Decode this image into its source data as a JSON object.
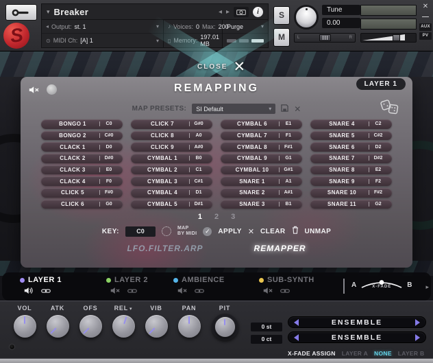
{
  "icons": {
    "close_x": "✕",
    "check": "✓",
    "caret_down": "▾",
    "caret_left": "◂",
    "caret_right": "▸",
    "minus": "—",
    "midi_plug": "⊙",
    "voices_note": "♪",
    "memory_chip": "▯",
    "info": "i",
    "logo_s": "S"
  },
  "colors": {
    "accent_purple": "#857ae8",
    "accent_cyan": "#62cfe3",
    "pink_glow": "#ce2c5c",
    "layer1_dot": "#a18cf2",
    "layer2_dot": "#8bd264",
    "ambience_dot": "#55b4e8",
    "subsynth_dot": "#e9c44f",
    "logo_red": "#c1272d"
  },
  "kontakt_header": {
    "title": "Breaker",
    "output": {
      "label": "Output:",
      "value": "st. 1"
    },
    "midi": {
      "label": "MIDI Ch:",
      "value": "[A] 1"
    },
    "voices": {
      "label": "Voices:",
      "value": "0"
    },
    "max": {
      "label": "Max:",
      "value": "200"
    },
    "memory": {
      "label": "Memory:",
      "value": "197.01 MB"
    },
    "purge_label": "Purge",
    "solo_label": "S",
    "mute_label": "M",
    "tune_label": "Tune",
    "tune_value": "0.00",
    "pan_left": "L",
    "pan_right": "R",
    "aux_label": "AUX",
    "pv_label": "PV"
  },
  "stage": {
    "close_label": "CLOSE"
  },
  "panel": {
    "title": "REMAPPING",
    "layer_badge": "LAYER 1",
    "presets_label": "MAP PRESETS:",
    "preset_value": "SI Default",
    "columns": [
      [
        {
          "name": "BONGO 1",
          "key": "C0"
        },
        {
          "name": "BONGO 2",
          "key": "C#0"
        },
        {
          "name": "CLACK 1",
          "key": "D0"
        },
        {
          "name": "CLACK 2",
          "key": "D#0"
        },
        {
          "name": "CLACK 3",
          "key": "E0"
        },
        {
          "name": "CLACK 4",
          "key": "F0"
        },
        {
          "name": "CLICK 5",
          "key": "F#0"
        },
        {
          "name": "CLICK 6",
          "key": "G0"
        }
      ],
      [
        {
          "name": "CLICK 7",
          "key": "G#0"
        },
        {
          "name": "CLICK 8",
          "key": "A0"
        },
        {
          "name": "CLICK 9",
          "key": "A#0"
        },
        {
          "name": "CYMBAL 1",
          "key": "B0"
        },
        {
          "name": "CYMBAL 2",
          "key": "C1"
        },
        {
          "name": "CYMBAL 3",
          "key": "C#1"
        },
        {
          "name": "CYMBAL 4",
          "key": "D1"
        },
        {
          "name": "CYMBAL 5",
          "key": "D#1"
        }
      ],
      [
        {
          "name": "CYMBAL 6",
          "key": "E1"
        },
        {
          "name": "CYMBAL 7",
          "key": "F1"
        },
        {
          "name": "CYMBAL 8",
          "key": "F#1"
        },
        {
          "name": "CYMBAL 9",
          "key": "G1"
        },
        {
          "name": "CYMBAL 10",
          "key": "G#1"
        },
        {
          "name": "SNARE 1",
          "key": "A1"
        },
        {
          "name": "SNARE 2",
          "key": "A#1"
        },
        {
          "name": "SNARE 3",
          "key": "B1"
        }
      ],
      [
        {
          "name": "SNARE 4",
          "key": "C2"
        },
        {
          "name": "SNARE 5",
          "key": "C#2"
        },
        {
          "name": "SNARE 6",
          "key": "D2"
        },
        {
          "name": "SNARE 7",
          "key": "D#2"
        },
        {
          "name": "SNARE 8",
          "key": "E2"
        },
        {
          "name": "SNARE 9",
          "key": "F2"
        },
        {
          "name": "SNARE 10",
          "key": "F#2"
        },
        {
          "name": "SNARE 11",
          "key": "G2"
        }
      ]
    ],
    "pages": [
      {
        "label": "1",
        "active": true
      },
      {
        "label": "2",
        "active": false
      },
      {
        "label": "3",
        "active": false
      }
    ],
    "key_label": "KEY:",
    "key_value": "C0",
    "map_by_midi_line1": "MAP",
    "map_by_midi_line2": "BY MIDI",
    "apply_label": "APPLY",
    "clear_label": "CLEAR",
    "unmap_label": "UNMAP",
    "tabs": [
      {
        "label": "LFO.FILTER.ARP",
        "active": false
      },
      {
        "label": "REMAPPER",
        "active": true
      }
    ]
  },
  "layer_bar": {
    "layers": [
      {
        "label": "LAYER 1",
        "dot_color": "#a18cf2",
        "muted": false,
        "active": true
      },
      {
        "label": "LAYER 2",
        "dot_color": "#8bd264",
        "muted": true,
        "active": false
      },
      {
        "label": "AMBIENCE",
        "dot_color": "#55b4e8",
        "muted": true,
        "active": false
      },
      {
        "label": "SUB-SYNTH",
        "dot_color": "#e9c44f",
        "muted": true,
        "active": false
      }
    ],
    "xfade": {
      "a": "A",
      "b": "B",
      "label": "X-FADE"
    }
  },
  "bottom": {
    "knobs": [
      {
        "label": "VOL",
        "angle": 0,
        "dropdown": false,
        "ring": false
      },
      {
        "label": "ATK",
        "angle": -135,
        "dropdown": false,
        "ring": false
      },
      {
        "label": "OFS",
        "angle": -135,
        "dropdown": false,
        "ring": false
      },
      {
        "label": "REL",
        "angle": 18,
        "dropdown": true,
        "ring": false
      },
      {
        "label": "VIB",
        "angle": -135,
        "dropdown": false,
        "ring": false
      },
      {
        "label": "PAN",
        "angle": 0,
        "dropdown": false,
        "ring": false
      },
      {
        "label": "PIT",
        "angle": 0,
        "dropdown": false,
        "ring": true
      }
    ],
    "pitch_semitones": "0 st",
    "pitch_cents": "0 ct",
    "selectors": [
      {
        "value": "ENSEMBLE"
      },
      {
        "value": "ENSEMBLE"
      }
    ],
    "xfade_assign": {
      "label": "X-FADE ASSIGN",
      "options": [
        {
          "label": "LAYER A",
          "active": false
        },
        {
          "label": "NONE",
          "active": true
        },
        {
          "label": "LAYER B",
          "active": false
        }
      ]
    }
  }
}
